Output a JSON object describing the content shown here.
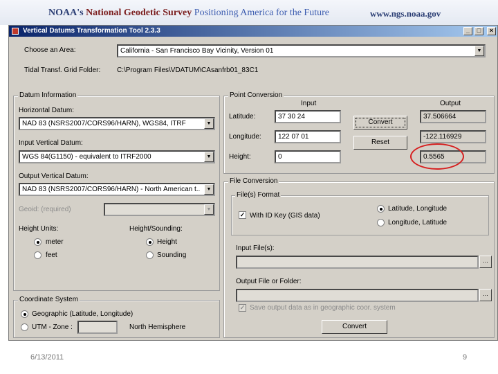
{
  "banner": {
    "prefix": "NOAA's",
    "org": "National Geodetic Survey",
    "tagline": "Positioning America for the Future",
    "url": "www.ngs.noaa.gov"
  },
  "window": {
    "title": "Vertical Datums Transformation Tool 2.3.3",
    "minimize": "_",
    "maximize": "□",
    "close": "×"
  },
  "area": {
    "label": "Choose an Area:",
    "value": "California - San Francisco Bay Vicinity, Version 01"
  },
  "grid_folder": {
    "label": "Tidal Transf. Grid Folder:",
    "value": "C:\\Program Files\\VDATUM\\CAsanfrb01_83C1"
  },
  "datum_info": {
    "title": "Datum Information",
    "horizontal_label": "Horizontal Datum:",
    "horizontal_value": "NAD 83 (NSRS2007/CORS96/HARN), WGS84, ITRF",
    "input_vertical_label": "Input Vertical Datum:",
    "input_vertical_value": "WGS 84(G1150) - equivalent to ITRF2000",
    "output_vertical_label": "Output Vertical Datum:",
    "output_vertical_value": "NAD 83 (NSRS2007/CORS96/HARN) - North American t...",
    "geoid_label": "Geoid: (required)",
    "height_units_label": "Height Units:",
    "unit_meter": "meter",
    "unit_feet": "feet",
    "height_sounding_label": "Height/Sounding:",
    "opt_height": "Height",
    "opt_sounding": "Sounding"
  },
  "coordinate_system": {
    "title": "Coordinate System",
    "geographic": "Geographic (Latitude, Longitude)",
    "utm": "UTM - Zone :",
    "hemisphere": "North Hemisphere"
  },
  "point_conversion": {
    "title": "Point Conversion",
    "input_header": "Input",
    "output_header": "Output",
    "latitude_label": "Latitude:",
    "latitude_input": "37 30 24",
    "latitude_output": "37.506664",
    "longitude_label": "Longitude:",
    "longitude_input": "122 07 01",
    "longitude_output": "-122.116929",
    "height_label": "Height:",
    "height_input": "0",
    "height_output": "0.5565",
    "convert_button": "Convert",
    "reset_button": "Reset"
  },
  "file_conversion": {
    "title": "File Conversion",
    "format_title": "File(s) Format",
    "with_id_key": "With ID Key (GIS data)",
    "lat_long": "Latitude, Longitude",
    "long_lat": "Longitude, Latitude",
    "input_files_label": "Input File(s):",
    "input_browse": "...",
    "output_label": "Output File or Folder:",
    "output_browse": "...",
    "save_geographic": "Save output data as in geographic coor. system",
    "convert_button": "Convert"
  },
  "footer": {
    "date": "6/13/2011",
    "page": "9"
  }
}
